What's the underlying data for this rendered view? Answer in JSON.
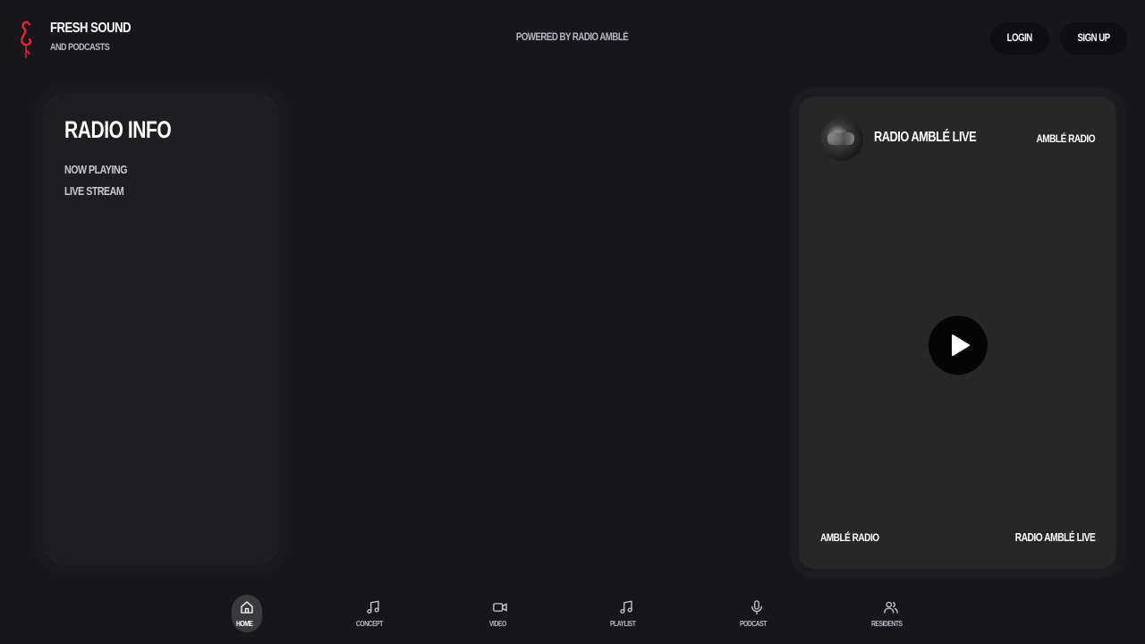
{
  "brand": {
    "title": "FRESH SOUND",
    "subtitle": "AND PODCASTS",
    "logo_icon": "flamingo-icon",
    "logo_color": "#e0243c"
  },
  "header": {
    "powered_by": "POWERED BY RADIO AMBLÈ",
    "login_label": "LOGIN",
    "signup_label": "SIGN UP"
  },
  "radio_info": {
    "title": "RADIO INFO",
    "links": [
      "NOW PLAYING",
      "LIVE STREAM"
    ]
  },
  "player": {
    "title": "RADIO AMBLÉ LIVE",
    "station": "AMBLÉ RADIO",
    "footer_left": "AMBLÉ RADIO",
    "footer_right": "RADIO AMBLÉ LIVE",
    "play_icon": "play-icon"
  },
  "nav": {
    "items": [
      {
        "label": "HOME",
        "icon": "home-icon",
        "active": true
      },
      {
        "label": "CONCEPT",
        "icon": "music-note-icon"
      },
      {
        "label": "VIDEO",
        "icon": "video-camera-icon"
      },
      {
        "label": "PLAYLIST",
        "icon": "music-note-icon"
      },
      {
        "label": "PODCAST",
        "icon": "microphone-icon"
      },
      {
        "label": "RESIDENTS",
        "icon": "users-icon"
      }
    ]
  },
  "colors": {
    "background": "#17161b",
    "panel": "#1e1e20",
    "player_card": "#272727",
    "accent": "#e0243c"
  }
}
